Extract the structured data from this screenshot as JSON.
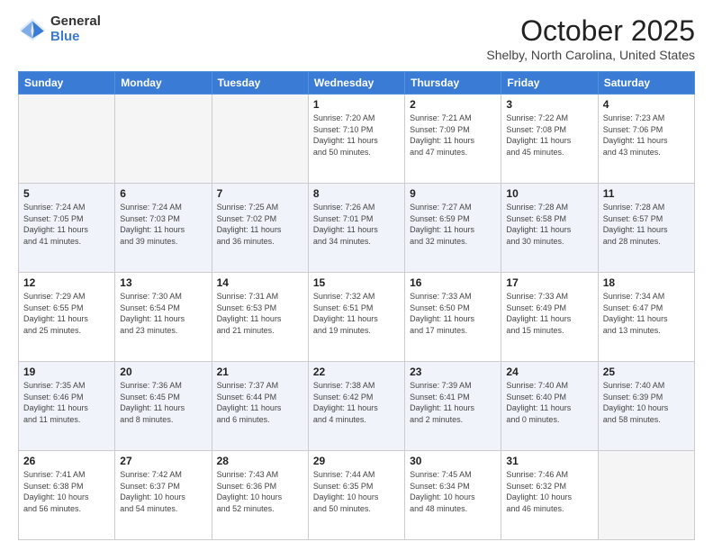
{
  "header": {
    "logo_general": "General",
    "logo_blue": "Blue",
    "month_title": "October 2025",
    "location": "Shelby, North Carolina, United States"
  },
  "days_of_week": [
    "Sunday",
    "Monday",
    "Tuesday",
    "Wednesday",
    "Thursday",
    "Friday",
    "Saturday"
  ],
  "weeks": [
    [
      {
        "day": "",
        "info": ""
      },
      {
        "day": "",
        "info": ""
      },
      {
        "day": "",
        "info": ""
      },
      {
        "day": "1",
        "info": "Sunrise: 7:20 AM\nSunset: 7:10 PM\nDaylight: 11 hours\nand 50 minutes."
      },
      {
        "day": "2",
        "info": "Sunrise: 7:21 AM\nSunset: 7:09 PM\nDaylight: 11 hours\nand 47 minutes."
      },
      {
        "day": "3",
        "info": "Sunrise: 7:22 AM\nSunset: 7:08 PM\nDaylight: 11 hours\nand 45 minutes."
      },
      {
        "day": "4",
        "info": "Sunrise: 7:23 AM\nSunset: 7:06 PM\nDaylight: 11 hours\nand 43 minutes."
      }
    ],
    [
      {
        "day": "5",
        "info": "Sunrise: 7:24 AM\nSunset: 7:05 PM\nDaylight: 11 hours\nand 41 minutes."
      },
      {
        "day": "6",
        "info": "Sunrise: 7:24 AM\nSunset: 7:03 PM\nDaylight: 11 hours\nand 39 minutes."
      },
      {
        "day": "7",
        "info": "Sunrise: 7:25 AM\nSunset: 7:02 PM\nDaylight: 11 hours\nand 36 minutes."
      },
      {
        "day": "8",
        "info": "Sunrise: 7:26 AM\nSunset: 7:01 PM\nDaylight: 11 hours\nand 34 minutes."
      },
      {
        "day": "9",
        "info": "Sunrise: 7:27 AM\nSunset: 6:59 PM\nDaylight: 11 hours\nand 32 minutes."
      },
      {
        "day": "10",
        "info": "Sunrise: 7:28 AM\nSunset: 6:58 PM\nDaylight: 11 hours\nand 30 minutes."
      },
      {
        "day": "11",
        "info": "Sunrise: 7:28 AM\nSunset: 6:57 PM\nDaylight: 11 hours\nand 28 minutes."
      }
    ],
    [
      {
        "day": "12",
        "info": "Sunrise: 7:29 AM\nSunset: 6:55 PM\nDaylight: 11 hours\nand 25 minutes."
      },
      {
        "day": "13",
        "info": "Sunrise: 7:30 AM\nSunset: 6:54 PM\nDaylight: 11 hours\nand 23 minutes."
      },
      {
        "day": "14",
        "info": "Sunrise: 7:31 AM\nSunset: 6:53 PM\nDaylight: 11 hours\nand 21 minutes."
      },
      {
        "day": "15",
        "info": "Sunrise: 7:32 AM\nSunset: 6:51 PM\nDaylight: 11 hours\nand 19 minutes."
      },
      {
        "day": "16",
        "info": "Sunrise: 7:33 AM\nSunset: 6:50 PM\nDaylight: 11 hours\nand 17 minutes."
      },
      {
        "day": "17",
        "info": "Sunrise: 7:33 AM\nSunset: 6:49 PM\nDaylight: 11 hours\nand 15 minutes."
      },
      {
        "day": "18",
        "info": "Sunrise: 7:34 AM\nSunset: 6:47 PM\nDaylight: 11 hours\nand 13 minutes."
      }
    ],
    [
      {
        "day": "19",
        "info": "Sunrise: 7:35 AM\nSunset: 6:46 PM\nDaylight: 11 hours\nand 11 minutes."
      },
      {
        "day": "20",
        "info": "Sunrise: 7:36 AM\nSunset: 6:45 PM\nDaylight: 11 hours\nand 8 minutes."
      },
      {
        "day": "21",
        "info": "Sunrise: 7:37 AM\nSunset: 6:44 PM\nDaylight: 11 hours\nand 6 minutes."
      },
      {
        "day": "22",
        "info": "Sunrise: 7:38 AM\nSunset: 6:42 PM\nDaylight: 11 hours\nand 4 minutes."
      },
      {
        "day": "23",
        "info": "Sunrise: 7:39 AM\nSunset: 6:41 PM\nDaylight: 11 hours\nand 2 minutes."
      },
      {
        "day": "24",
        "info": "Sunrise: 7:40 AM\nSunset: 6:40 PM\nDaylight: 11 hours\nand 0 minutes."
      },
      {
        "day": "25",
        "info": "Sunrise: 7:40 AM\nSunset: 6:39 PM\nDaylight: 10 hours\nand 58 minutes."
      }
    ],
    [
      {
        "day": "26",
        "info": "Sunrise: 7:41 AM\nSunset: 6:38 PM\nDaylight: 10 hours\nand 56 minutes."
      },
      {
        "day": "27",
        "info": "Sunrise: 7:42 AM\nSunset: 6:37 PM\nDaylight: 10 hours\nand 54 minutes."
      },
      {
        "day": "28",
        "info": "Sunrise: 7:43 AM\nSunset: 6:36 PM\nDaylight: 10 hours\nand 52 minutes."
      },
      {
        "day": "29",
        "info": "Sunrise: 7:44 AM\nSunset: 6:35 PM\nDaylight: 10 hours\nand 50 minutes."
      },
      {
        "day": "30",
        "info": "Sunrise: 7:45 AM\nSunset: 6:34 PM\nDaylight: 10 hours\nand 48 minutes."
      },
      {
        "day": "31",
        "info": "Sunrise: 7:46 AM\nSunset: 6:32 PM\nDaylight: 10 hours\nand 46 minutes."
      },
      {
        "day": "",
        "info": ""
      }
    ]
  ],
  "shaded_rows": [
    1,
    3
  ]
}
